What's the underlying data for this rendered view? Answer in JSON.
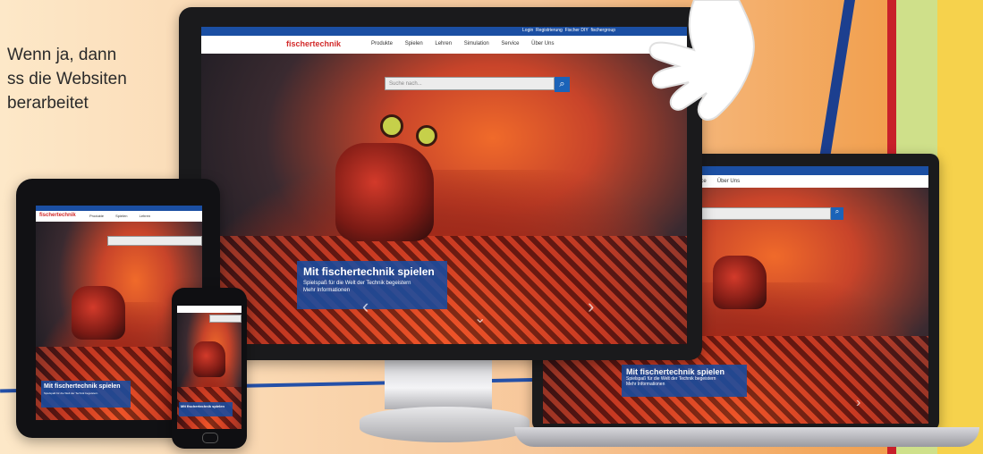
{
  "intro": {
    "line1": "Wenn ja, dann",
    "line2": "ss die Websiten",
    "line3": "berarbeitet"
  },
  "site": {
    "logo": "fischertechnik",
    "nav": [
      "Produkte",
      "Spielen",
      "Lehren",
      "Simulation",
      "Service",
      "Über Uns"
    ],
    "top_links": [
      "Login",
      "Registrierung",
      "Fischer DIY",
      "fischergroup",
      "Deutsch"
    ],
    "search_placeholder": "Suche nach...",
    "search_icon": "search-icon",
    "banner_title": "Mit fischertechnik spielen",
    "banner_sub": "Spielspaß für die Welt der Technik begeistern",
    "banner_link": "Mehr Informationen",
    "arrow_left": "‹",
    "arrow_right": "›",
    "arrow_down": "⌄"
  },
  "colors": {
    "brand_blue": "#1b4fa3",
    "brand_red": "#d22a2a",
    "stripe_red": "#c8202a",
    "stripe_green": "#cfe08a",
    "stripe_yellow": "#f6d24c"
  }
}
